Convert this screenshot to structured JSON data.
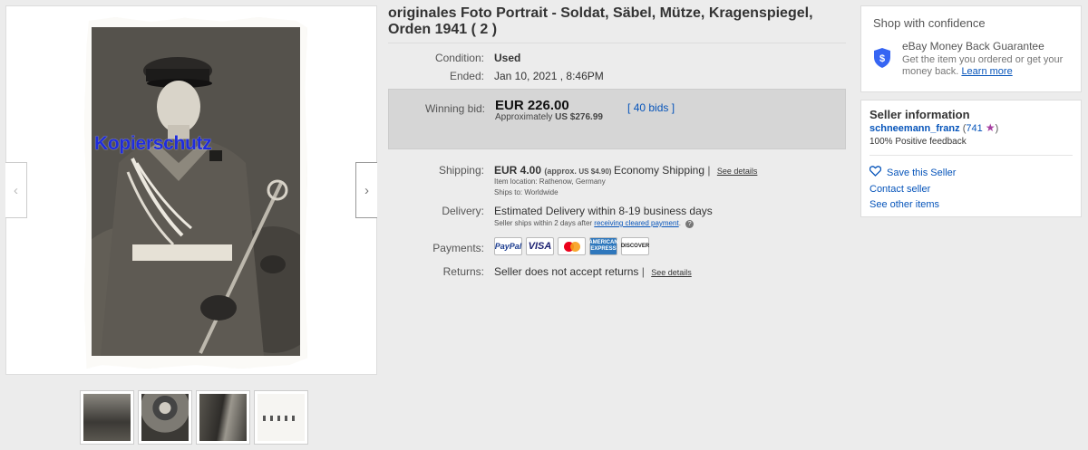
{
  "title": "originales Foto Portrait - Soldat, Säbel, Mütze, Kragenspiegel, Orden 1941 ( 2 )",
  "photo": {
    "watermark": "Kopierschutz"
  },
  "gallery": {
    "prev_icon": "chevron-left-icon",
    "next_icon": "chevron-right-icon",
    "prev_glyph": "‹",
    "next_glyph": "›"
  },
  "condition": {
    "label": "Condition:",
    "value": "Used"
  },
  "ended": {
    "label": "Ended:",
    "value": "Jan 10, 2021 , 8:46PM"
  },
  "bid": {
    "label": "Winning bid:",
    "amount": "EUR 226.00",
    "approx_prefix": "Approximately",
    "approx_value": "US $276.99",
    "bids_open": "[",
    "bids_link": "40 bids",
    "bids_close": "]"
  },
  "shipping": {
    "label": "Shipping:",
    "amount": "EUR 4.00",
    "approx": "(approx.",
    "approx_value": "US $4.90)",
    "method": "Economy Shipping",
    "sep": "|",
    "see_details": "See details",
    "location": "Item location:  Rathenow, Germany",
    "ships_to": "Ships to:  Worldwide"
  },
  "delivery": {
    "label": "Delivery:",
    "value": "Estimated Delivery within 8-19 business days",
    "note": "Seller ships within 2 days after",
    "note_link": "receiving cleared payment",
    "note_end": "."
  },
  "payments": {
    "label": "Payments:",
    "cards": [
      "PayPal",
      "VISA",
      "MasterCard",
      "AMERICAN EXPRESS",
      "DISCOVER"
    ]
  },
  "returns": {
    "label": "Returns:",
    "value": "Seller does not accept returns",
    "sep": "|",
    "see_details": "See details"
  },
  "confidence": {
    "title": "Shop with confidence",
    "guarantee_title": "eBay Money Back Guarantee",
    "guarantee_text": "Get the item you ordered or get your money back.",
    "learn_more": "Learn more"
  },
  "seller": {
    "title": "Seller information",
    "username": "schneemann_franz",
    "score_open": "(",
    "score": "741",
    "score_close": ")",
    "feedback": "100% Positive feedback",
    "save": "Save this Seller",
    "contact": "Contact seller",
    "other": "See other items"
  },
  "colors": {
    "link": "#0654ba",
    "star": "#a63ea0",
    "bidbox": "#d6d6d6",
    "watermark": "#1f2cdc"
  }
}
